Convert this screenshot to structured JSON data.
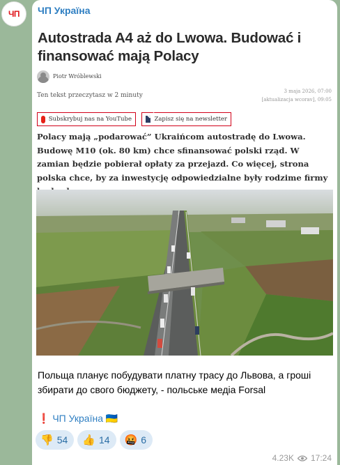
{
  "channel": {
    "avatar_text": "ЧП",
    "name": "ЧП Україна"
  },
  "article": {
    "headline": "Autostrada A4 aż do Lwowa. Budować i finansować mają Polacy",
    "author": "Piotr Wróblewski",
    "read_time": "Ten tekst przeczytasz w 2 minuty",
    "date": "3 maja 2026, 07:00",
    "updated": "[aktualizacja wcorav], 09:05",
    "youtube_button": "Subskrybuj nas na YouTube",
    "newsletter_button": "Zapisz się na newsletter",
    "lead": "Polacy mają „podarować” Ukraińcom autostradę do Lwowa. Budowę M10 (ok. 80 km) chce sfinansować polski rząd. W zamian będzie pobierał opłaty za przejazd. Co więcej, strona polska chce, by za inwestycję odpowiedzialne były rodzime firmy budowlane."
  },
  "post": {
    "caption": "Польща планує побудувати платну трасу до Львова, а гроші збирати до свого бюджету, - польське медіа Forsal",
    "signature": "❗ ЧП Україна 🇺🇦"
  },
  "reactions": [
    {
      "emoji": "👎",
      "count": "54"
    },
    {
      "emoji": "👍",
      "count": "14"
    },
    {
      "emoji": "🤬",
      "count": "6"
    }
  ],
  "meta": {
    "views": "4.23K",
    "time": "17:24"
  },
  "colors": {
    "background": "#9bb89a",
    "link_blue": "#2f7fc2",
    "reaction_bg": "#ddeaf6"
  }
}
